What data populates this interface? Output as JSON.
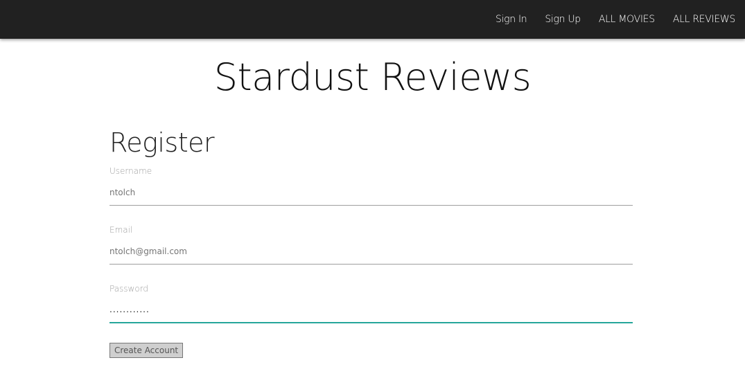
{
  "nav": {
    "items": [
      {
        "label": "Sign In"
      },
      {
        "label": "Sign Up"
      },
      {
        "label": "ALL MOVIES"
      },
      {
        "label": "ALL REVIEWS"
      }
    ]
  },
  "site": {
    "title": "Stardust Reviews"
  },
  "form": {
    "heading": "Register",
    "username": {
      "label": "Username",
      "value": "ntolch"
    },
    "email": {
      "label": "Email",
      "value": "ntolch@gmail.com"
    },
    "password": {
      "label": "Password",
      "value": "............"
    },
    "submit_label": "Create Account"
  },
  "colors": {
    "navbar": "#212121",
    "accent": "#26a69a"
  }
}
